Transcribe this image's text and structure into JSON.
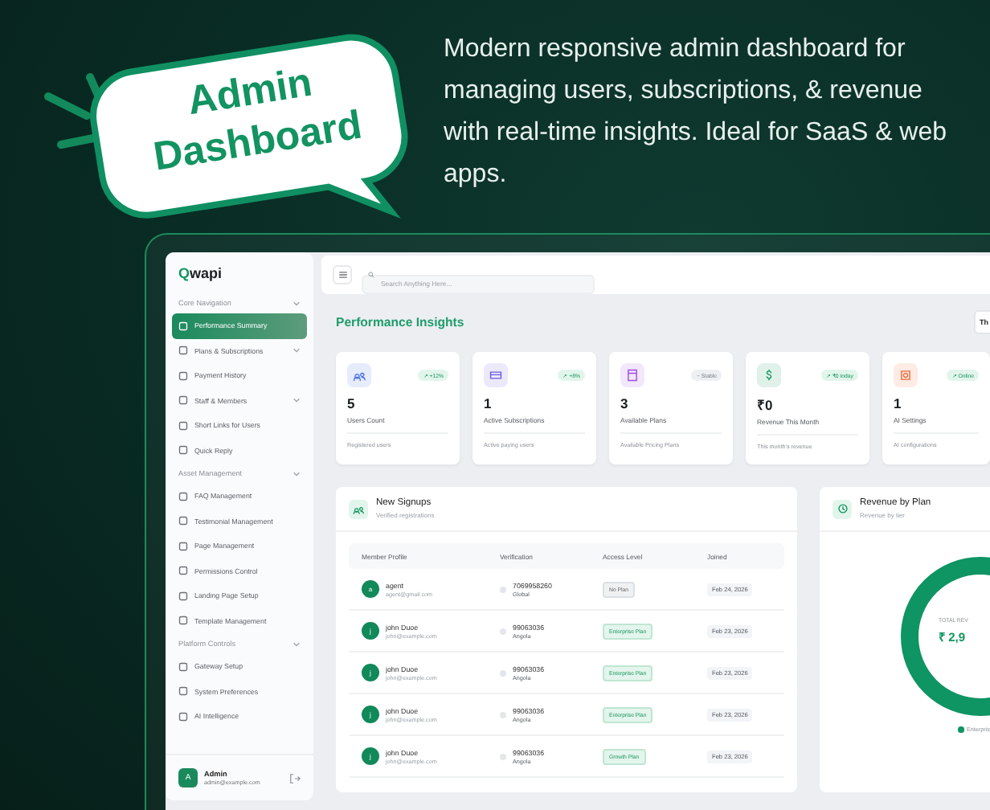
{
  "promo": {
    "bubble_lines": [
      "Admin",
      "Dashboard"
    ],
    "description": "Modern responsive admin dashboard for managing users, subscriptions, & revenue with real-time insights. Ideal for SaaS & web apps."
  },
  "sidebar": {
    "logo": {
      "mark": "Q",
      "name": "wapi"
    },
    "sections": [
      {
        "title": "Core Navigation",
        "expanded": true,
        "items": [
          {
            "label": "Performance Summary",
            "selected": true,
            "has_submenu": false
          },
          {
            "label": "Plans & Subscriptions",
            "selected": false,
            "has_submenu": true
          },
          {
            "label": "Payment History",
            "selected": false,
            "has_submenu": false
          },
          {
            "label": "Staff & Members",
            "selected": false,
            "has_submenu": true
          },
          {
            "label": "Short Links for Users",
            "selected": false,
            "has_submenu": false
          },
          {
            "label": "Quick Reply",
            "selected": false,
            "has_submenu": false
          }
        ]
      },
      {
        "title": "Asset Management",
        "expanded": true,
        "items": [
          {
            "label": "FAQ Management",
            "selected": false,
            "has_submenu": false
          },
          {
            "label": "Testimonial Management",
            "selected": false,
            "has_submenu": false
          },
          {
            "label": "Page Management",
            "selected": false,
            "has_submenu": false
          },
          {
            "label": "Permissions Control",
            "selected": false,
            "has_submenu": false
          },
          {
            "label": "Landing Page Setup",
            "selected": false,
            "has_submenu": false
          },
          {
            "label": "Template Management",
            "selected": false,
            "has_submenu": false
          }
        ]
      },
      {
        "title": "Platform Controls",
        "expanded": true,
        "items": [
          {
            "label": "Gateway Setup",
            "selected": false,
            "has_submenu": false
          },
          {
            "label": "System Preferences",
            "selected": false,
            "has_submenu": false
          },
          {
            "label": "AI Intelligence",
            "selected": false,
            "has_submenu": false
          }
        ]
      }
    ],
    "user": {
      "avatar": "A",
      "name": "Admin",
      "email": "admin@example.com"
    }
  },
  "topbar": {
    "search": {
      "placeholder": "Search Anything Here..."
    }
  },
  "page_title": "Performance Insights",
  "title_button": "Th",
  "stats": [
    {
      "badge": "↗ +12%",
      "kind": "up",
      "value": "5",
      "label": "Users Count",
      "note": "Registered users",
      "color": "#4a72e8"
    },
    {
      "badge": "↗ +8%",
      "kind": "up",
      "value": "1",
      "label": "Active Subscriptions",
      "note": "Active paying users",
      "color": "#6b5be0"
    },
    {
      "badge": "~ Stable",
      "kind": "flat",
      "value": "3",
      "label": "Available Plans",
      "note": "Available Pricing Plans",
      "color": "#a14be0"
    },
    {
      "badge": "↗ ₹0 today",
      "kind": "up",
      "value": "₹0",
      "label": "Revenue This Month",
      "note": "This month's revenue",
      "color": "#13945f"
    },
    {
      "badge": "↗ Online",
      "kind": "up",
      "value": "1",
      "label": "AI Settings",
      "note": "AI configurations",
      "color": "#ee6a35"
    }
  ],
  "signups": {
    "title": "New Signups",
    "subtitle": "Verified registrations",
    "columns": [
      "Member Profile",
      "Verification",
      "Access Level",
      "Joined"
    ],
    "rows": [
      {
        "avatar": "a",
        "name": "agent",
        "email": "agent@gmail.com",
        "phone": "7069958260",
        "country": "Global",
        "plan": "No Plan",
        "plan_active": false,
        "joined": "Feb 24, 2026"
      },
      {
        "avatar": "j",
        "name": "john Duoe",
        "email": "john@example.com",
        "phone": "99063036",
        "country": "Angola",
        "plan": "Enterprise Plan",
        "plan_active": true,
        "joined": "Feb 23, 2026"
      },
      {
        "avatar": "j",
        "name": "john Duoe",
        "email": "john@example.com",
        "phone": "99063036",
        "country": "Angola",
        "plan": "Enterprise Plan",
        "plan_active": true,
        "joined": "Feb 23, 2026"
      },
      {
        "avatar": "j",
        "name": "john Duoe",
        "email": "john@example.com",
        "phone": "99063036",
        "country": "Angola",
        "plan": "Enterprise Plan",
        "plan_active": true,
        "joined": "Feb 23, 2026"
      },
      {
        "avatar": "j",
        "name": "john Duoe",
        "email": "john@example.com",
        "phone": "99063036",
        "country": "Angola",
        "plan": "Growth Plan",
        "plan_active": true,
        "joined": "Feb 23, 2026"
      }
    ]
  },
  "revenue": {
    "title": "Revenue by Plan",
    "subtitle": "Revenue by tier",
    "total_label": "TOTAL REV",
    "total": "₹ 2,9",
    "legend": [
      {
        "label": "Enterpris",
        "color": "#0f9463"
      }
    ]
  }
}
